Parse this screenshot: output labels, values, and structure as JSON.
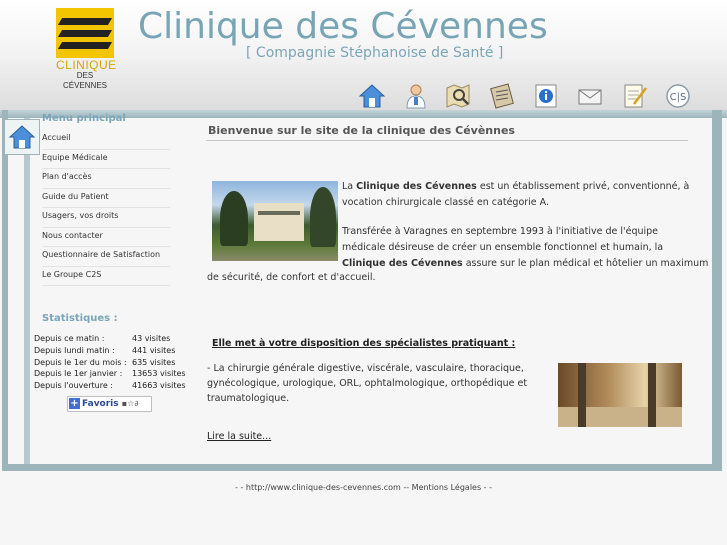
{
  "header": {
    "logo_text_top": "CLINIQUE",
    "logo_text_bottom": "DES CÉVENNES",
    "title": "Clinique des Cévennes",
    "subtitle": "[ Compagnie Stéphanoise de Santé ]"
  },
  "toolbar": {
    "icons": [
      "home-icon",
      "doctor-icon",
      "map-icon",
      "guide-icon",
      "info-icon",
      "mail-icon",
      "form-icon",
      "c2s-icon"
    ],
    "c2s_label": "C|S"
  },
  "sidebar": {
    "menu_title": "Menu principal",
    "items": [
      {
        "label": "Accueil"
      },
      {
        "label": "Equipe Médicale"
      },
      {
        "label": "Plan d'accès"
      },
      {
        "label": "Guide du Patient"
      },
      {
        "label": "Usagers, vos droits"
      },
      {
        "label": "Nous contacter"
      },
      {
        "label": "Questionnaire de Satisfaction"
      },
      {
        "label": "Le Groupe C2S"
      }
    ],
    "stats_title": "Statistiques :",
    "stats": [
      {
        "label": "Depuis ce matin :",
        "value": "43 visites"
      },
      {
        "label": "Depuis lundi matin :",
        "value": "441 visites"
      },
      {
        "label": "Depuis le 1er du mois :",
        "value": "635 visites"
      },
      {
        "label": "Depuis le 1er janvier :",
        "value": "13653 visites"
      },
      {
        "label": "Depuis l'ouverture :",
        "value": "41663 visites"
      }
    ],
    "favoris_label": "Favoris"
  },
  "main": {
    "heading": "Bienvenue sur le site de la clinique des Cévènnes",
    "para1_pre": "La ",
    "para1_bold": "Clinique des Cévennes",
    "para1_post": " est un établissement privé, conventionné, à",
    "para1_line2": "vocation chirurgicale classé en catégorie A.",
    "para2_line1": "Transférée à Varagnes en septembre 1993 à l'initiative de l'équipe",
    "para2_line2": "médicale désireuse de créer un ensemble fonctionnel et humain, la",
    "para2_bold": "Clinique des Cévennes",
    "para2_post": " assure sur le plan médical et hôtelier un maximum",
    "para2_line4": "de sécurité, de confort et d'accueil.",
    "section_title": "Elle met à votre disposition des spécialistes pratiquant :",
    "spec_line1": " - La chirurgie générale digestive, viscérale, vasculaire, thoracique,",
    "spec_line2": "gynécologique, urologique, ORL, ophtalmologique, orthopédique et",
    "spec_line3": "traumatologique.",
    "read_more": "Lire la suite..."
  },
  "footer": {
    "text": "- - http://www.clinique-des-cevennes.com -- Mentions Légales - -"
  },
  "colors": {
    "title": "#78a5b5",
    "frame": "#9bb5bb",
    "logo_yellow": "#f2c500"
  }
}
